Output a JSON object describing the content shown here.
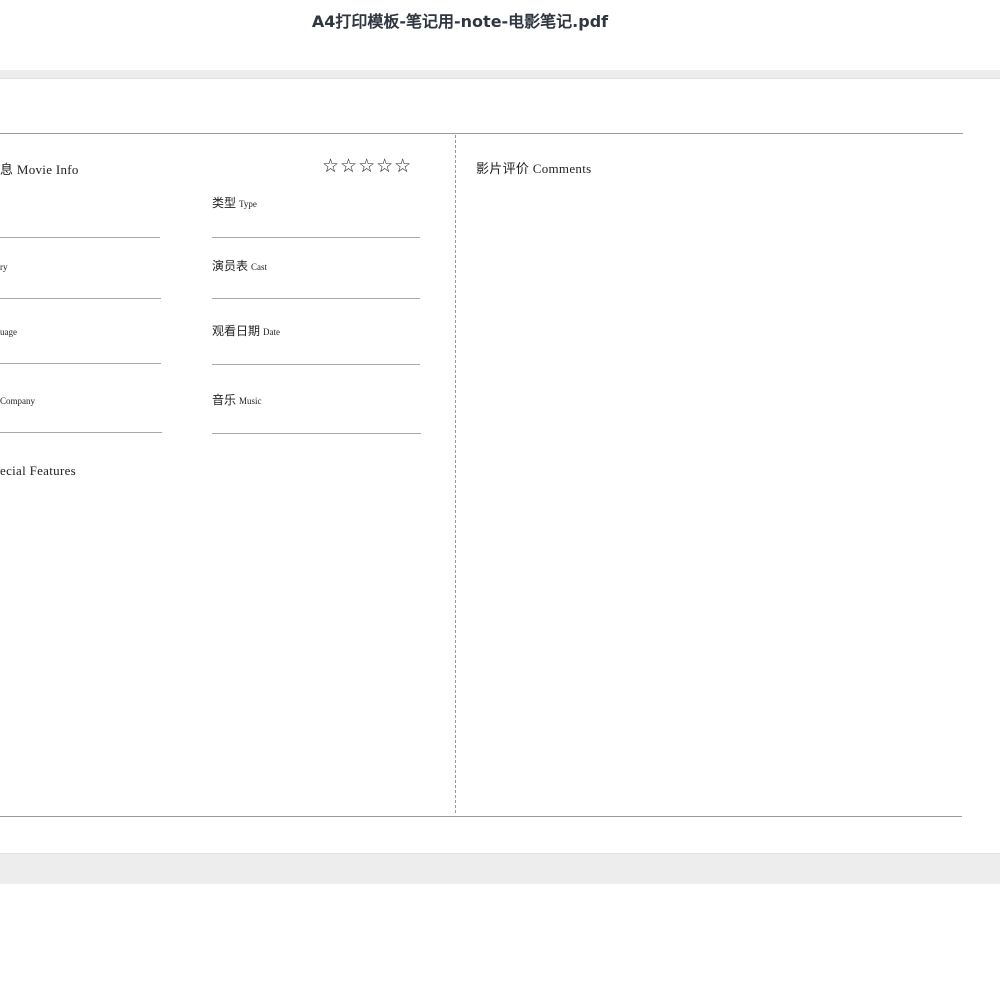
{
  "window": {
    "title": "A4打印模板-笔记用-note-电影笔记.pdf"
  },
  "document": {
    "movie_info": {
      "title_visible": "息 Movie Info",
      "rating_stars": "☆☆☆☆☆"
    },
    "comments": {
      "title": "影片评价 Comments"
    },
    "fields": {
      "type": {
        "cn": "类型",
        "en": "Type"
      },
      "cast": {
        "cn": "演员表",
        "en": "Cast"
      },
      "date": {
        "cn": "观看日期",
        "en": "Date"
      },
      "music": {
        "cn": "音乐",
        "en": "Music"
      },
      "left_row2": "ry",
      "left_row3": "uage",
      "left_row4": "Company"
    },
    "features": {
      "title_visible": "ecial Features"
    }
  }
}
